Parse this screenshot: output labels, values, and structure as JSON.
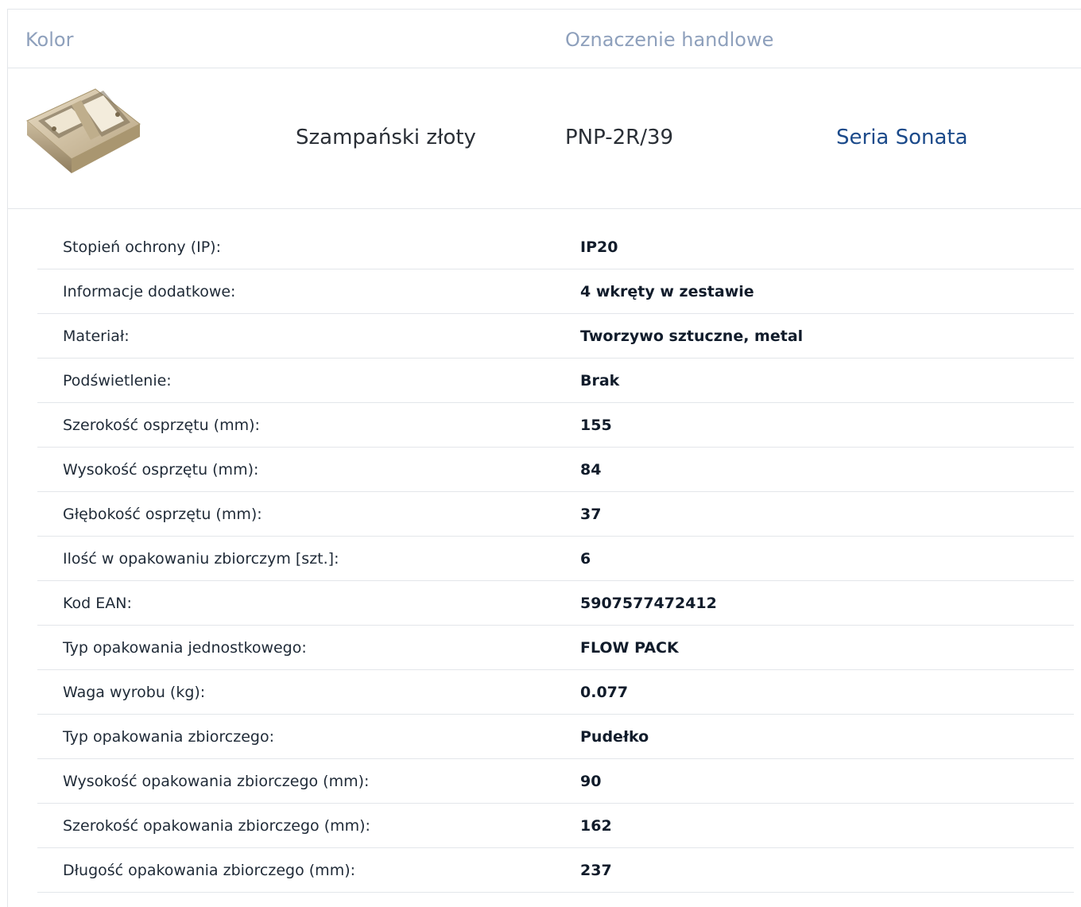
{
  "header": {
    "col_color": "Kolor",
    "col_trade_name": "Oznaczenie handlowe"
  },
  "product": {
    "image_icon": "product-photo-double-mounting-box",
    "color_name": "Szampański złoty",
    "code": "PNP-2R/39",
    "series_link": "Seria Sonata"
  },
  "specs": [
    {
      "label": "Stopień ochrony (IP):",
      "value": "IP20"
    },
    {
      "label": "Informacje dodatkowe:",
      "value": "4 wkręty w zestawie"
    },
    {
      "label": "Materiał:",
      "value": "Tworzywo sztuczne, metal"
    },
    {
      "label": "Podświetlenie:",
      "value": "Brak"
    },
    {
      "label": "Szerokość osprzętu (mm):",
      "value": "155"
    },
    {
      "label": "Wysokość osprzętu (mm):",
      "value": "84"
    },
    {
      "label": "Głębokość osprzętu (mm):",
      "value": "37"
    },
    {
      "label": "Ilość w opakowaniu zbiorczym [szt.]:",
      "value": "6"
    },
    {
      "label": "Kod EAN:",
      "value": "5907577472412"
    },
    {
      "label": "Typ opakowania jednostkowego:",
      "value": "FLOW PACK"
    },
    {
      "label": "Waga wyrobu (kg):",
      "value": "0.077"
    },
    {
      "label": "Typ opakowania zbiorczego:",
      "value": "Pudełko"
    },
    {
      "label": "Wysokość opakowania zbiorczego (mm):",
      "value": "90"
    },
    {
      "label": "Szerokość opakowania zbiorczego (mm):",
      "value": "162"
    },
    {
      "label": "Długość opakowania zbiorczego (mm):",
      "value": "237"
    }
  ],
  "colors": {
    "header_text": "#8ea0bc",
    "link": "#1b4a8a",
    "divider": "#e3e6ea",
    "product_finish": "#c9b89a"
  }
}
